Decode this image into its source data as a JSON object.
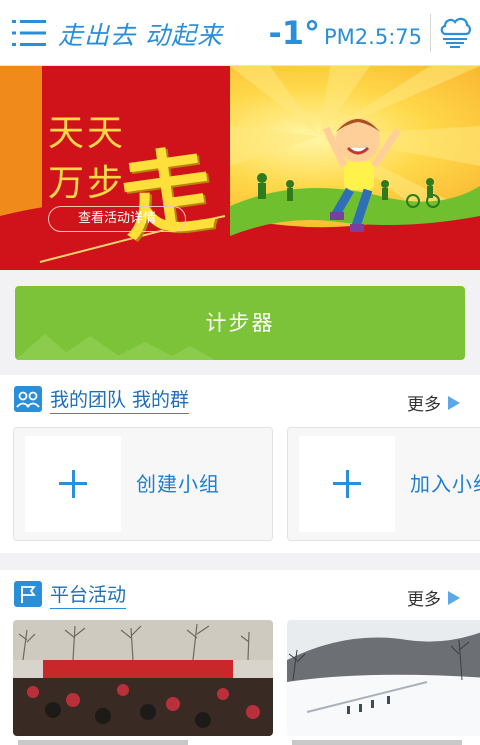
{
  "header": {
    "slogan": "走出去 动起来",
    "temperature": "-1°",
    "air_quality": "PM2.5:75",
    "menu_icon": "menu-icon",
    "weather_icon": "cloud-weather-icon"
  },
  "banner": {
    "title_line1": "天天",
    "title_line2": "万步",
    "title_big": "走",
    "detail_link": "查看活动详情"
  },
  "pedometer": {
    "label": "计步器"
  },
  "team": {
    "title": "我的团队 我的群",
    "more": "更多",
    "create_label": "创建小组",
    "join_label": "加入小组"
  },
  "activity": {
    "title": "平台活动",
    "more": "更多"
  },
  "colors": {
    "accent": "#2a8fd8",
    "pedometer_green": "#7cc33a",
    "banner_red": "#d0121b",
    "banner_yellow": "#ffd94a"
  }
}
